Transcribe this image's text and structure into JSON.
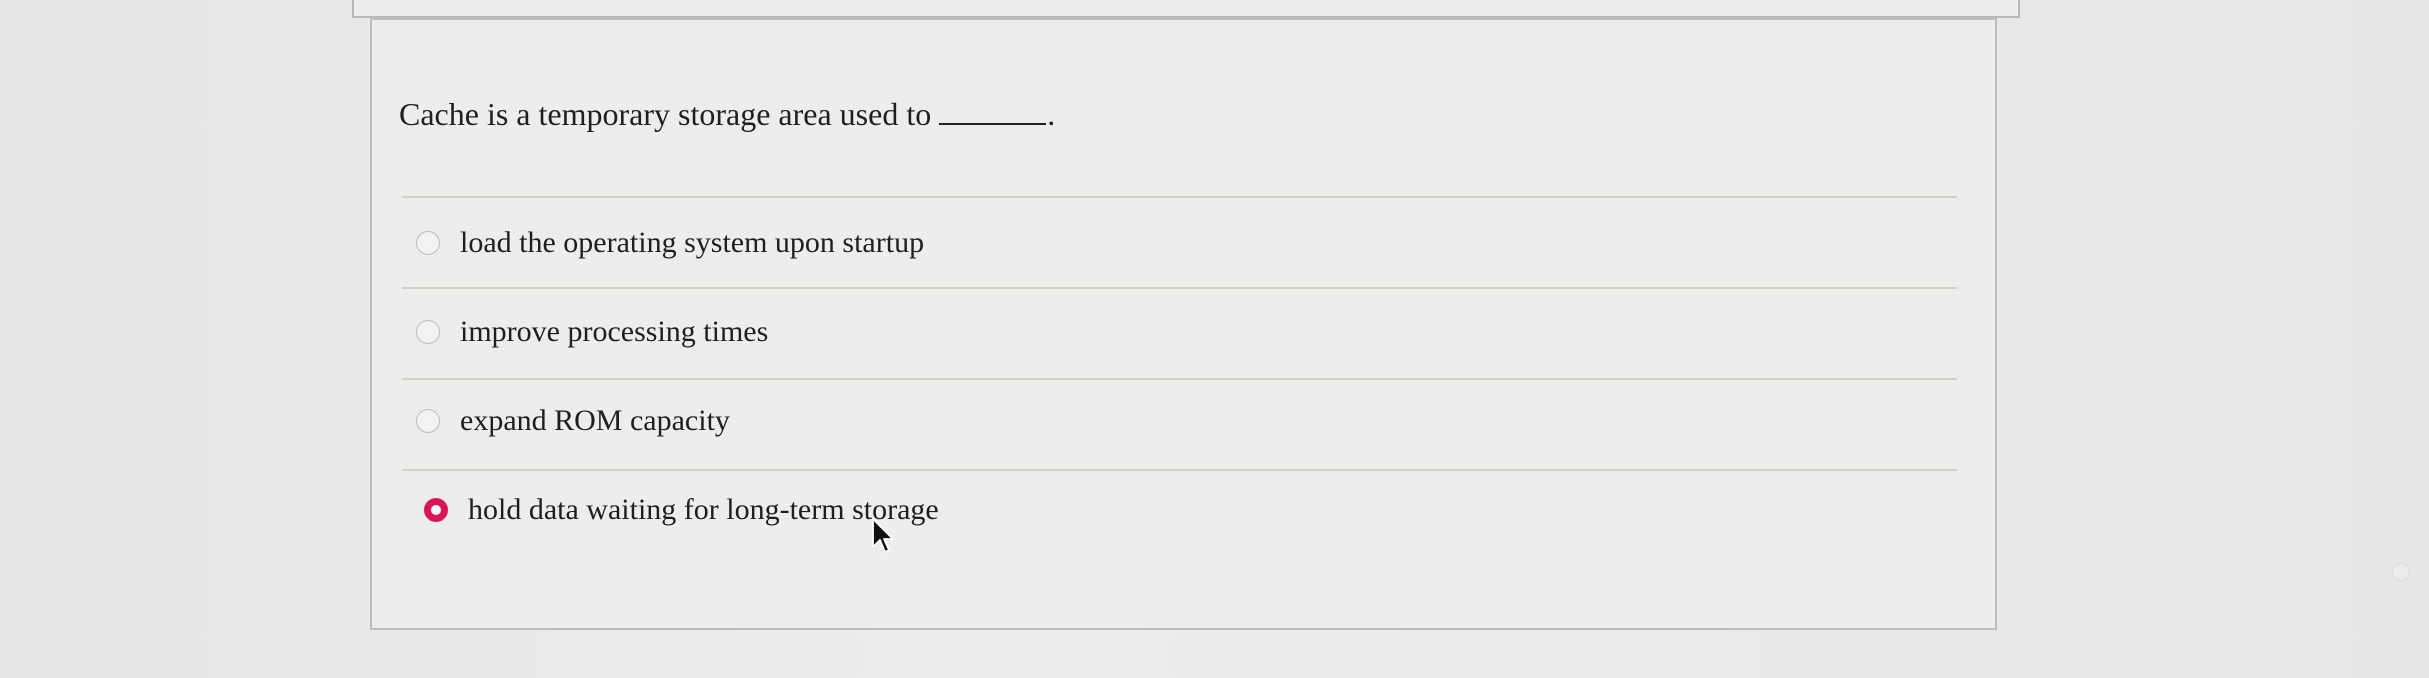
{
  "question": {
    "prompt": "Cache is a temporary storage area used to",
    "blank_suffix": "."
  },
  "options": [
    {
      "label": "load the operating system upon startup",
      "selected": false
    },
    {
      "label": "improve processing times",
      "selected": false
    },
    {
      "label": "expand ROM capacity",
      "selected": false
    },
    {
      "label": "hold data waiting for long-term storage",
      "selected": true
    }
  ],
  "colors": {
    "selected_radio": "#d6185a",
    "background": "#e9e9e7",
    "text": "#1f1f1f"
  },
  "icons": {
    "cursor": "mouse-pointer-icon",
    "radio": "radio-button-icon",
    "decorative_dot": "circle-dot-icon"
  }
}
